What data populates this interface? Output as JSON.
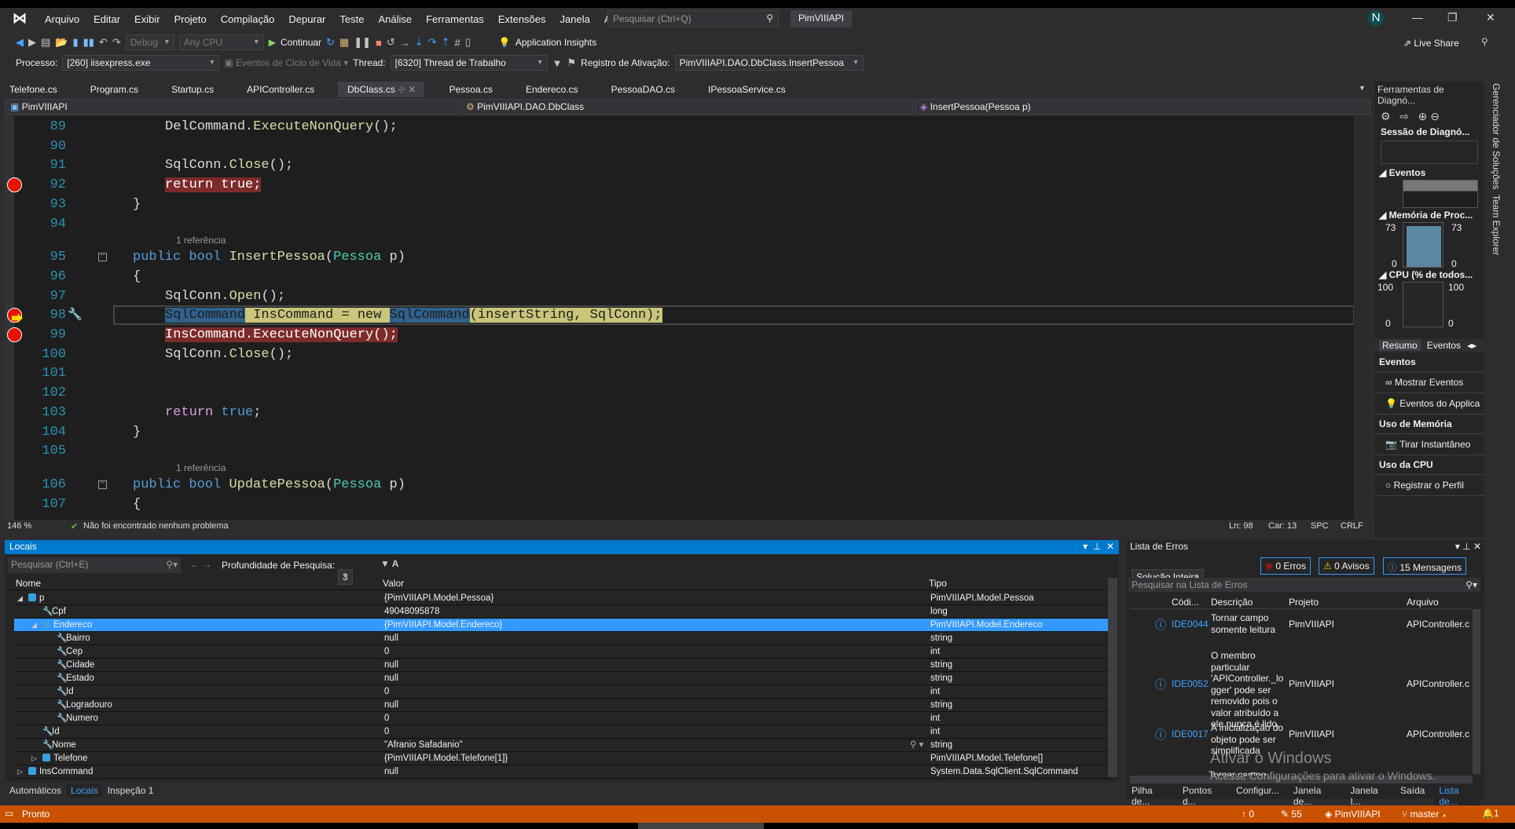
{
  "app": {
    "solution_name": "PimVIIIAPI",
    "user_initial": "N"
  },
  "menu": [
    "Arquivo",
    "Editar",
    "Exibir",
    "Projeto",
    "Compilação",
    "Depurar",
    "Teste",
    "Análise",
    "Ferramentas",
    "Extensões",
    "Janela",
    "Ajuda"
  ],
  "search": {
    "placeholder": "Pesquisar (Ctrl+Q)"
  },
  "toolbar": {
    "config": "Debug",
    "platform": "Any CPU",
    "continue_label": "Continuar",
    "app_insights": "Application Insights",
    "live_share": "Live Share"
  },
  "debug_toolbar": {
    "process_label": "Processo:",
    "process_value": "[260] iisexpress.exe",
    "lifecycle": "Eventos de Ciclo de Vida",
    "thread_label": "Thread:",
    "thread_value": "[6320] Thread de Trabalho",
    "stack_label": "Registro de Ativação:",
    "stack_value": "PimVIIIAPI.DAO.DbClass.InsertPessoa"
  },
  "tabs": [
    {
      "label": "Telefone.cs"
    },
    {
      "label": "Program.cs"
    },
    {
      "label": "Startup.cs"
    },
    {
      "label": "APIController.cs"
    },
    {
      "label": "DbClass.cs",
      "active": true
    },
    {
      "label": "Pessoa.cs"
    },
    {
      "label": "Endereco.cs"
    },
    {
      "label": "PessoaDAO.cs"
    },
    {
      "label": "IPessoaService.cs"
    }
  ],
  "navbar": {
    "project": "PimVIIIAPI",
    "class": "PimVIIIAPI.DAO.DbClass",
    "member": "InsertPessoa(Pessoa p)"
  },
  "code": [
    {
      "n": "89",
      "indent": 3,
      "tokens": [
        [
          "DelCommand",
          "p"
        ],
        [
          ".",
          "p"
        ],
        [
          "ExecuteNonQuery",
          "m"
        ],
        [
          "();",
          "p"
        ]
      ]
    },
    {
      "n": "90",
      "indent": 3,
      "tokens": []
    },
    {
      "n": "91",
      "indent": 3,
      "tokens": [
        [
          "SqlConn",
          "p"
        ],
        [
          ".",
          "p"
        ],
        [
          "Close",
          "m"
        ],
        [
          "();",
          "p"
        ]
      ]
    },
    {
      "n": "92",
      "indent": 3,
      "bp": true,
      "hl": "bp",
      "tokens": [
        [
          "return true;",
          "p"
        ]
      ]
    },
    {
      "n": "93",
      "indent": 2,
      "tokens": [
        [
          "}",
          "p"
        ]
      ]
    },
    {
      "n": "94",
      "indent": 2,
      "tokens": []
    },
    {
      "lens": "1 referência"
    },
    {
      "n": "95",
      "indent": 2,
      "fold": true,
      "tokens": [
        [
          "public ",
          "k"
        ],
        [
          "bool ",
          "k"
        ],
        [
          "InsertPessoa",
          "m"
        ],
        [
          "(",
          "p"
        ],
        [
          "Pessoa ",
          "t"
        ],
        [
          "p",
          "p"
        ],
        [
          ")",
          "p"
        ]
      ]
    },
    {
      "n": "96",
      "indent": 2,
      "tokens": [
        [
          "{",
          "p"
        ]
      ]
    },
    {
      "n": "97",
      "indent": 3,
      "tokens": [
        [
          "SqlConn",
          "p"
        ],
        [
          ".",
          "p"
        ],
        [
          "Open",
          "m"
        ],
        [
          "();",
          "p"
        ]
      ]
    },
    {
      "n": "98",
      "indent": 3,
      "current": true,
      "hl": "cur",
      "tokens": [
        [
          "SqlCommand",
          "ref"
        ],
        [
          " InsCommand = new ",
          "cur"
        ],
        [
          "SqlCommand",
          "ref"
        ],
        [
          "(insertString, SqlConn);",
          "cur"
        ]
      ]
    },
    {
      "n": "99",
      "indent": 3,
      "bp": true,
      "hl": "bp",
      "tokens": [
        [
          "InsCommand.ExecuteNonQuery();",
          "p"
        ]
      ]
    },
    {
      "n": "100",
      "indent": 3,
      "tokens": [
        [
          "SqlConn",
          "p"
        ],
        [
          ".",
          "p"
        ],
        [
          "Close",
          "m"
        ],
        [
          "();",
          "p"
        ]
      ]
    },
    {
      "n": "101",
      "indent": 3,
      "tokens": []
    },
    {
      "n": "102",
      "indent": 3,
      "tokens": []
    },
    {
      "n": "103",
      "indent": 3,
      "tokens": [
        [
          "return ",
          "r"
        ],
        [
          "true",
          "k"
        ],
        [
          ";",
          "p"
        ]
      ]
    },
    {
      "n": "104",
      "indent": 2,
      "tokens": [
        [
          "}",
          "p"
        ]
      ]
    },
    {
      "n": "105",
      "indent": 2,
      "tokens": []
    },
    {
      "lens": "1 referência"
    },
    {
      "n": "106",
      "indent": 2,
      "fold": true,
      "tokens": [
        [
          "public ",
          "k"
        ],
        [
          "bool ",
          "k"
        ],
        [
          "UpdatePessoa",
          "m"
        ],
        [
          "(",
          "p"
        ],
        [
          "Pessoa ",
          "t"
        ],
        [
          "p",
          "p"
        ],
        [
          ")",
          "p"
        ]
      ]
    },
    {
      "n": "107",
      "indent": 2,
      "tokens": [
        [
          "{",
          "p"
        ]
      ]
    }
  ],
  "editor_status": {
    "zoom": "146 %",
    "issues": "Não foi encontrado nenhum problema",
    "line": "Ln: 98",
    "col": "Car: 13",
    "spacing": "SPC",
    "eol": "CRLF"
  },
  "locals": {
    "title": "Locais",
    "search_placeholder": "Pesquisar (Ctrl+E)",
    "depth_label": "Profundidade de Pesquisa:",
    "depth_value": "3",
    "columns": [
      "Nome",
      "Valor",
      "Tipo"
    ],
    "rows": [
      {
        "name": "p",
        "value": "{PimVIIIAPI.Model.Pessoa}",
        "type": "PimVIIIAPI.Model.Pessoa",
        "level": 0,
        "exp": "open",
        "icon": "object"
      },
      {
        "name": "Cpf",
        "value": "49048095878",
        "type": "long",
        "level": 1,
        "icon": "property"
      },
      {
        "name": "Endereco",
        "value": "{PimVIIIAPI.Model.Endereco}",
        "type": "PimVIIIAPI.Model.Endereco",
        "level": 1,
        "exp": "open",
        "icon": "object",
        "selected": true
      },
      {
        "name": "Bairro",
        "value": "null",
        "type": "string",
        "level": 2,
        "icon": "property"
      },
      {
        "name": "Cep",
        "value": "0",
        "type": "int",
        "level": 2,
        "icon": "property"
      },
      {
        "name": "Cidade",
        "value": "null",
        "type": "string",
        "level": 2,
        "icon": "property"
      },
      {
        "name": "Estado",
        "value": "null",
        "type": "string",
        "level": 2,
        "icon": "property"
      },
      {
        "name": "Id",
        "value": "0",
        "type": "int",
        "level": 2,
        "icon": "property"
      },
      {
        "name": "Logradouro",
        "value": "null",
        "type": "string",
        "level": 2,
        "icon": "property"
      },
      {
        "name": "Numero",
        "value": "0",
        "type": "int",
        "level": 2,
        "icon": "property"
      },
      {
        "name": "Id",
        "value": "0",
        "type": "int",
        "level": 1,
        "icon": "property"
      },
      {
        "name": "Nome",
        "value": "\"Afranio Safadanio\"",
        "type": "string",
        "level": 1,
        "icon": "property",
        "viewer": true
      },
      {
        "name": "Telefone",
        "value": "{PimVIIIAPI.Model.Telefone[1]}",
        "type": "PimVIIIAPI.Model.Telefone[]",
        "level": 1,
        "exp": "closed",
        "icon": "object"
      },
      {
        "name": "InsCommand",
        "value": "null",
        "type": "System.Data.SqlClient.SqlCommand",
        "level": 0,
        "exp": "closed",
        "icon": "object"
      }
    ],
    "bottom_tabs": [
      {
        "label": "Automáticos"
      },
      {
        "label": "Locais",
        "active": true
      },
      {
        "label": "Inspeção 1"
      }
    ]
  },
  "error_list": {
    "title": "Lista de Erros",
    "scope": "Solução Inteira",
    "errors": "0 Erros",
    "warnings": "0 Avisos",
    "messages": "15 Mensagens",
    "search_placeholder": "Pesquisar na Lista de Erros",
    "columns": [
      "Códi...",
      "Descrição",
      "Projeto",
      "Arquivo"
    ],
    "rows": [
      {
        "code": "IDE0044",
        "desc": "Tornar campo somente leitura",
        "project": "PimVIIIAPI",
        "file": "APIController.c"
      },
      {
        "code": "IDE0052",
        "desc": "O membro particular 'APIController._lo gger' pode ser removido pois o valor atribuído a ele nunca é lido.",
        "project": "PimVIIIAPI",
        "file": "APIController.c"
      },
      {
        "code": "IDE0017",
        "desc": "A inicialização do objeto pode ser simplificada",
        "project": "PimVIIIAPI",
        "file": "APIController.c"
      }
    ],
    "partial_row": "Tornar campo",
    "bottom_tabs": [
      {
        "label": "Pilha de..."
      },
      {
        "label": "Pontos d..."
      },
      {
        "label": "Configur..."
      },
      {
        "label": "Janela de..."
      },
      {
        "label": "Janela I..."
      },
      {
        "label": "Saída"
      },
      {
        "label": "Lista de...",
        "active": true
      }
    ]
  },
  "diagnostics": {
    "title": "Ferramentas de Diagnó...",
    "session": "Sessão de Diagnó...",
    "events_header": "Eventos",
    "memory_header": "Memória de Proc...",
    "memory_max": "73",
    "memory_min": "0",
    "cpu_header": "CPU (% de todos...",
    "cpu_max": "100",
    "cpu_min": "0",
    "tabs": [
      "Resumo",
      "Eventos"
    ],
    "sections": [
      {
        "title": "Eventos",
        "items": [
          "Mostrar Eventos",
          "Eventos do Applica"
        ]
      },
      {
        "title": "Uso de Memória",
        "items": [
          "Tirar Instantâneo"
        ]
      },
      {
        "title": "Uso da CPU",
        "items": [
          "Registrar o Perfil"
        ]
      }
    ]
  },
  "side_tabs": [
    "Gerenciador de Soluções",
    "Team Explorer"
  ],
  "watermark": {
    "line1": "Ativar o Windows",
    "line2": "Acesse Configurações para ativar o Windows."
  },
  "statusbar": {
    "ready": "Pronto",
    "up": "0",
    "changes": "55",
    "repo": "PimVIIIAPI",
    "branch": "master",
    "notifications": "1"
  },
  "colors": {
    "accent": "#007acc",
    "status_debug": "#ca5100",
    "breakpoint": "#e51400",
    "selection": "#3399ff"
  }
}
